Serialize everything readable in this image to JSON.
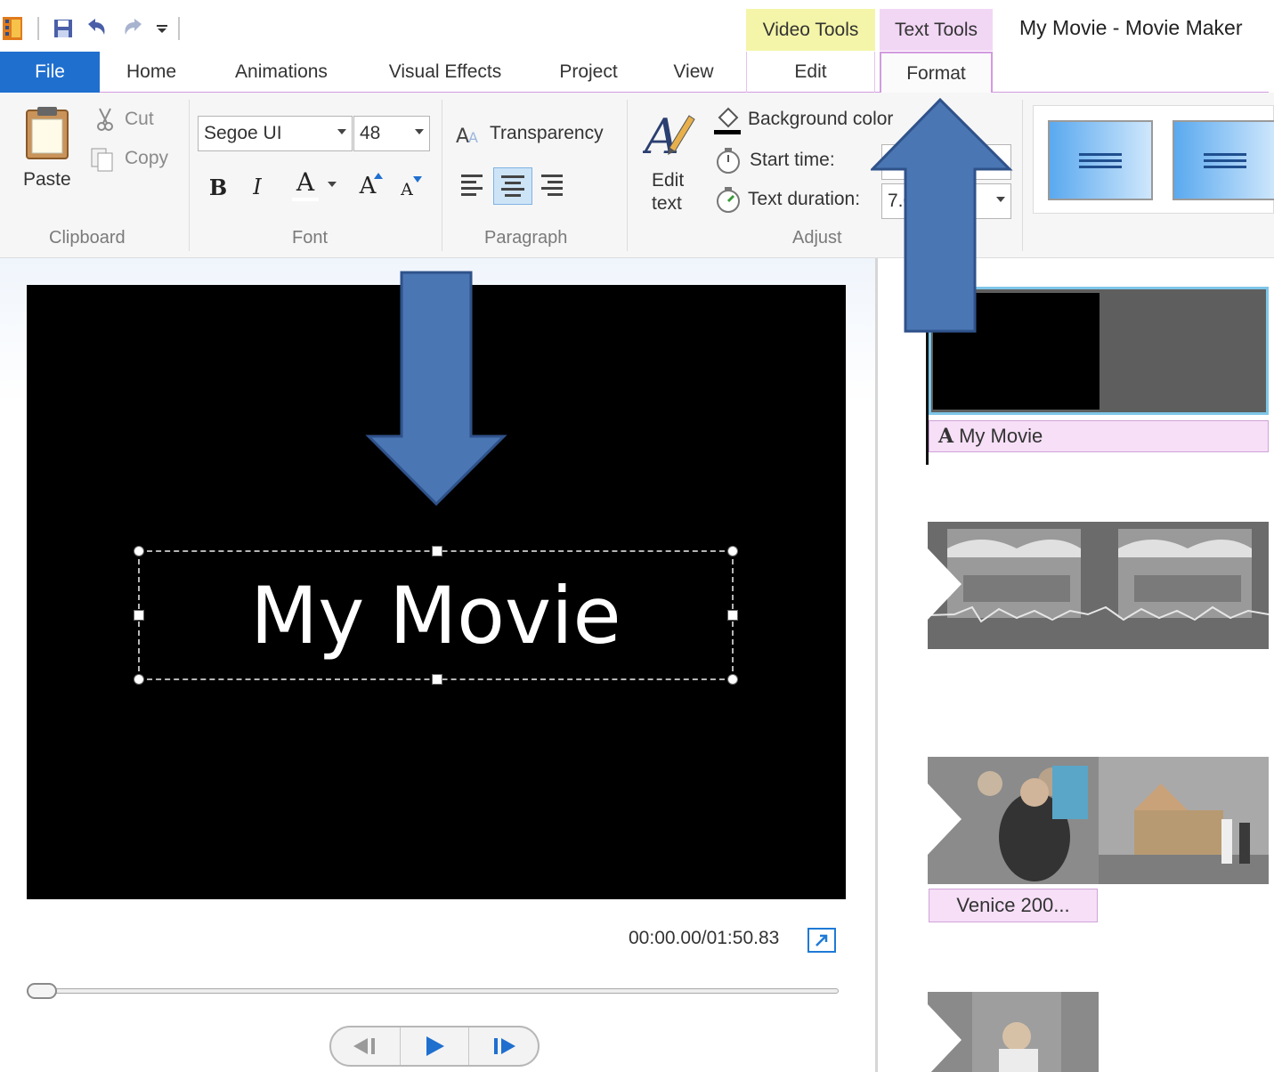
{
  "titlebar": {
    "app_title": "My Movie - Movie Maker",
    "context_tabs": {
      "video_tools": "Video Tools",
      "text_tools": "Text Tools"
    }
  },
  "tabs": {
    "file": "File",
    "home": "Home",
    "animations": "Animations",
    "visual_effects": "Visual Effects",
    "project": "Project",
    "view": "View",
    "edit": "Edit",
    "format": "Format"
  },
  "ribbon": {
    "clipboard": {
      "label": "Clipboard",
      "paste": "Paste",
      "cut": "Cut",
      "copy": "Copy"
    },
    "font": {
      "label": "Font",
      "family": "Segoe UI",
      "size": "48",
      "bold": "B",
      "italic": "I",
      "color": "A",
      "grow": "A",
      "shrink": "A"
    },
    "paragraph": {
      "label": "Paragraph",
      "transparency": "Transparency"
    },
    "adjust": {
      "label": "Adjust",
      "edit_text_line1": "Edit",
      "edit_text_line2": "text",
      "background_color": "Background color",
      "start_time": "Start time:",
      "text_duration": "Text duration:",
      "text_duration_value": "7.0"
    }
  },
  "preview": {
    "title_text": "My Movie",
    "timecode": "00:00.00/01:50.83",
    "progress_fraction": 0.0
  },
  "storyboard": {
    "clip1_caption": "My Movie",
    "clip3_caption": "Venice 200..."
  },
  "colors": {
    "file_tab": "#1f6fcf",
    "video_tools": "#f4f5a8",
    "text_tools": "#f2d7f5",
    "annotation_arrow": "#4a76b3",
    "selection_border": "#7ec6e8"
  }
}
